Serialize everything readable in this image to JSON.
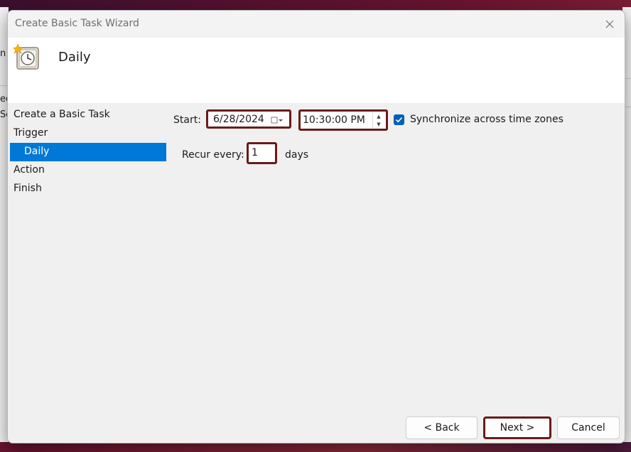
{
  "window": {
    "title": "Create Basic Task Wizard"
  },
  "background_fragments": {
    "left_glyphs": [
      "ed",
      "Sc",
      "n"
    ]
  },
  "header": {
    "heading": "Daily",
    "icon": "scheduled-task-clock-icon"
  },
  "nav": {
    "items": [
      {
        "label": "Create a Basic Task",
        "selected": false,
        "sub": false
      },
      {
        "label": "Trigger",
        "selected": false,
        "sub": false
      },
      {
        "label": "Daily",
        "selected": true,
        "sub": true
      },
      {
        "label": "Action",
        "selected": false,
        "sub": false
      },
      {
        "label": "Finish",
        "selected": false,
        "sub": false
      }
    ]
  },
  "form": {
    "start_label": "Start:",
    "date_value": "6/28/2024",
    "time_value": "10:30:00 PM",
    "sync_label": "Synchronize across time zones",
    "sync_checked": true,
    "recur_label": "Recur every:",
    "recur_value": "1",
    "recur_unit": "days"
  },
  "buttons": {
    "back": "< Back",
    "next": "Next >",
    "cancel": "Cancel"
  },
  "colors": {
    "selection": "#0078d7",
    "checkbox": "#005fb8",
    "highlight_border": "#6b1a1a"
  }
}
